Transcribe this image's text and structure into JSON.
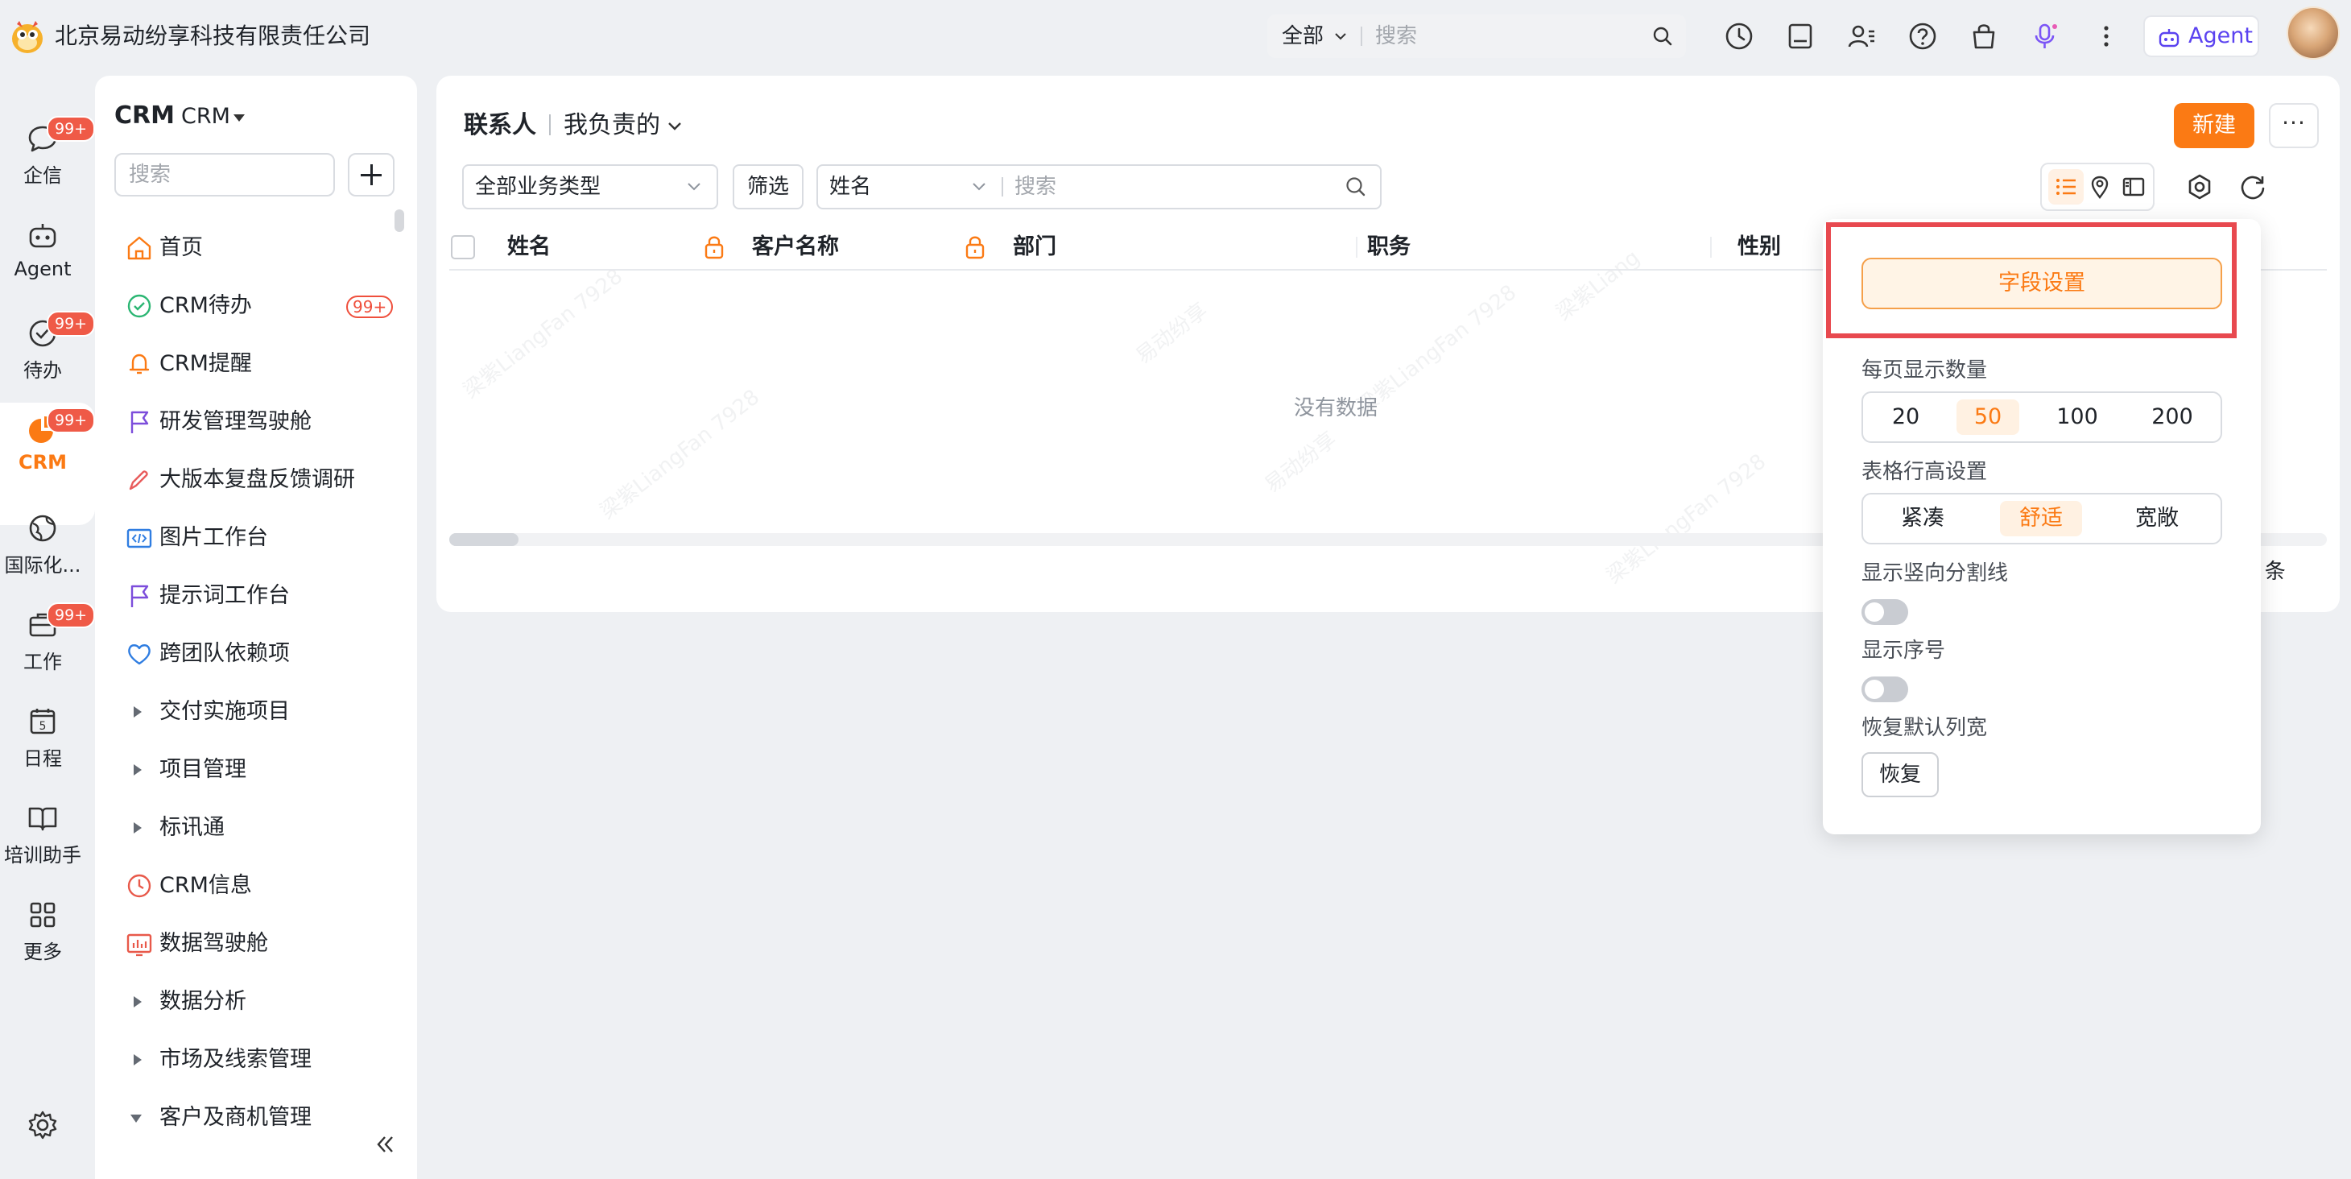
{
  "app": {
    "company_name": "北京易动纷享科技有限责任公司",
    "brand_color": "#fb7a14",
    "agent_color": "#5b43f0"
  },
  "top_search": {
    "scope": "全部",
    "placeholder": "搜索"
  },
  "top_icons": [
    "history-icon",
    "document-icon",
    "contacts-icon",
    "help-icon",
    "bag-icon",
    "microphone-icon",
    "more-vertical-icon"
  ],
  "agent_button": {
    "label": "Agent"
  },
  "rail": [
    {
      "label": "企信",
      "icon": "chat-icon",
      "badge": "99+"
    },
    {
      "label": "Agent",
      "icon": "robot-icon",
      "badge": ""
    },
    {
      "label": "待办",
      "icon": "check-circle-icon",
      "badge": "99+"
    },
    {
      "label": "CRM",
      "icon": "pie-chart-icon",
      "badge": "99+",
      "active": true
    },
    {
      "label": "国际化...",
      "icon": "globe-icon",
      "badge": ""
    },
    {
      "label": "工作",
      "icon": "briefcase-icon",
      "badge": "99+"
    },
    {
      "label": "日程",
      "icon": "calendar-icon",
      "badge": ""
    },
    {
      "label": "培训助手",
      "icon": "book-icon",
      "badge": ""
    },
    {
      "label": "更多",
      "icon": "grid-icon",
      "badge": ""
    }
  ],
  "sidebar": {
    "title_bold": "CRM",
    "title_sub": "CRM",
    "search_placeholder": "搜索",
    "items": [
      {
        "label": "首页",
        "icon": "home-icon"
      },
      {
        "label": "CRM待办",
        "icon": "check-circle-icon",
        "badge": "99+"
      },
      {
        "label": "CRM提醒",
        "icon": "bell-icon"
      },
      {
        "label": "研发管理驾驶舱",
        "icon": "flag-icon"
      },
      {
        "label": "大版本复盘反馈调研",
        "icon": "feedback-icon"
      },
      {
        "label": "图片工作台",
        "icon": "code-image-icon"
      },
      {
        "label": "提示词工作台",
        "icon": "flag-icon"
      },
      {
        "label": "跨团队依赖项",
        "icon": "heart-icon"
      },
      {
        "label": "交付实施项目",
        "icon": "expand-triangle-icon"
      },
      {
        "label": "项目管理",
        "icon": "expand-triangle-icon"
      },
      {
        "label": "标讯通",
        "icon": "expand-triangle-icon"
      },
      {
        "label": "CRM信息",
        "icon": "clock-icon"
      },
      {
        "label": "数据驾驶舱",
        "icon": "dashboard-icon"
      },
      {
        "label": "数据分析",
        "icon": "expand-triangle-icon"
      },
      {
        "label": "市场及线索管理",
        "icon": "expand-triangle-icon"
      },
      {
        "label": "客户及商机管理",
        "icon": "collapse-triangle-icon"
      }
    ]
  },
  "main": {
    "object_name": "联系人",
    "scope": "我负责的",
    "new_button": "新建",
    "more_button": "···",
    "biz_type_select": "全部业务类型",
    "filter_button": "筛选",
    "search_field": "姓名",
    "search_placeholder": "搜索",
    "columns": [
      "姓名",
      "客户名称",
      "部门",
      "职务",
      "性别"
    ],
    "empty_text": "没有数据",
    "count_tail": "0 条"
  },
  "settings_popover": {
    "field_settings": "字段设置",
    "page_size_label": "每页显示数量",
    "page_sizes": [
      "20",
      "50",
      "100",
      "200"
    ],
    "page_size_selected": "50",
    "row_height_label": "表格行高设置",
    "row_heights": [
      "紧凑",
      "舒适",
      "宽敞"
    ],
    "row_height_selected": "舒适",
    "vertical_divider_label": "显示竖向分割线",
    "vertical_divider_on": false,
    "show_index_label": "显示序号",
    "show_index_on": false,
    "restore_width_label": "恢复默认列宽",
    "restore_button": "恢复"
  }
}
